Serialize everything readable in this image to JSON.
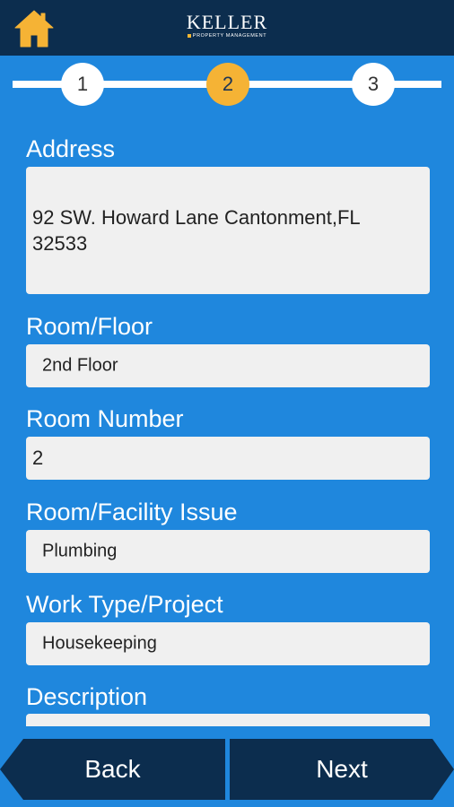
{
  "brand": {
    "name": "KELLER",
    "tagline": "PROPERTY MANAGEMENT",
    "colors": {
      "header": "#0c2d4e",
      "background": "#1f87dd",
      "accent": "#f5b335"
    }
  },
  "header": {
    "home_icon": "home-icon"
  },
  "stepper": {
    "steps": [
      "1",
      "2",
      "3"
    ],
    "active_step": "2"
  },
  "form": {
    "address": {
      "label": "Address",
      "value": "92 SW. Howard Lane Cantonment,FL 32533"
    },
    "room_floor": {
      "label": "Room/Floor",
      "value": "2nd Floor"
    },
    "room_number": {
      "label": "Room Number",
      "value": "2"
    },
    "facility_issue": {
      "label": "Room/Facility Issue",
      "value": "Plumbing"
    },
    "work_type": {
      "label": "Work Type/Project",
      "value": "Housekeeping"
    },
    "description": {
      "label": "Description",
      "value": ""
    }
  },
  "nav": {
    "back_label": "Back",
    "next_label": "Next"
  }
}
